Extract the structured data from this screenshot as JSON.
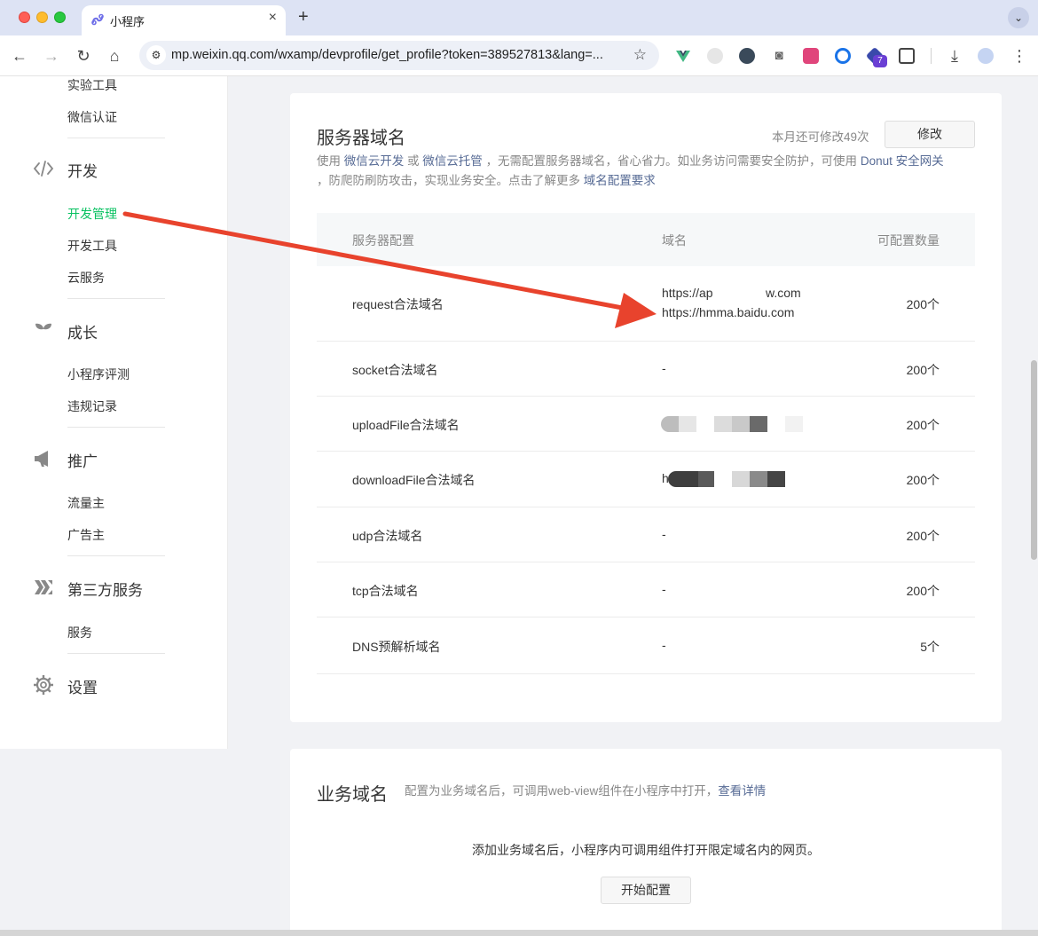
{
  "browser": {
    "tab_title": "小程序",
    "url": "mp.weixin.qq.com/wxamp/devprofile/get_profile?token=389527813&lang=...",
    "ext_badge": "7"
  },
  "sidebar": {
    "items_top": [
      "实验工具",
      "微信认证"
    ],
    "sections": [
      {
        "icon": "code-icon",
        "title": "开发",
        "items": [
          "开发管理",
          "开发工具",
          "云服务"
        ]
      },
      {
        "icon": "sprout-icon",
        "title": "成长",
        "items": [
          "小程序评测",
          "违规记录"
        ]
      },
      {
        "icon": "megaphone-icon",
        "title": "推广",
        "items": [
          "流量主",
          "广告主"
        ]
      },
      {
        "icon": "third-party-icon",
        "title": "第三方服务",
        "items": [
          "服务"
        ]
      },
      {
        "icon": "gear-icon",
        "title": "设置",
        "items": []
      }
    ],
    "active_item": "开发管理"
  },
  "server_domain": {
    "title": "服务器域名",
    "quota": "本月还可修改49次",
    "modify_button": "修改",
    "desc": {
      "p1": "使用",
      "link1": "微信云开发",
      "p2": "或",
      "link2": "微信云托管",
      "p3": "，无需配置服务器域名，省心省力。如业务访问需要安全防护，可使用",
      "link3": "Donut 安全网关",
      "p4": "，防爬防刷防攻击，实现业务安全。点击了解更多",
      "link4": "域名配置要求"
    },
    "columns": [
      "服务器配置",
      "域名",
      "可配置数量"
    ],
    "rows": [
      {
        "type": "request合法域名",
        "domains": [
          "https://ap",
          "w.com",
          "https://hmma.baidu.com"
        ],
        "count": "200个"
      },
      {
        "type": "socket合法域名",
        "domain": "-",
        "count": "200个"
      },
      {
        "type": "uploadFile合法域名",
        "domain": "",
        "count": "200个"
      },
      {
        "type": "downloadFile合法域名",
        "domain": "h",
        "count": "200个"
      },
      {
        "type": "udp合法域名",
        "domain": "-",
        "count": "200个"
      },
      {
        "type": "tcp合法域名",
        "domain": "-",
        "count": "200个"
      },
      {
        "type": "DNS预解析域名",
        "domain": "-",
        "count": "5个"
      }
    ]
  },
  "business_domain": {
    "title": "业务域名",
    "desc": "配置为业务域名后，可调用web-view组件在小程序中打开，",
    "link": "查看详情",
    "empty_text": "添加业务域名后，小程序内可调用组件打开限定域名内的网页。",
    "start_button": "开始配置"
  },
  "colors": {
    "active_green": "#07c160",
    "link_blue": "#576b95",
    "arrow_red": "#e8432d"
  }
}
